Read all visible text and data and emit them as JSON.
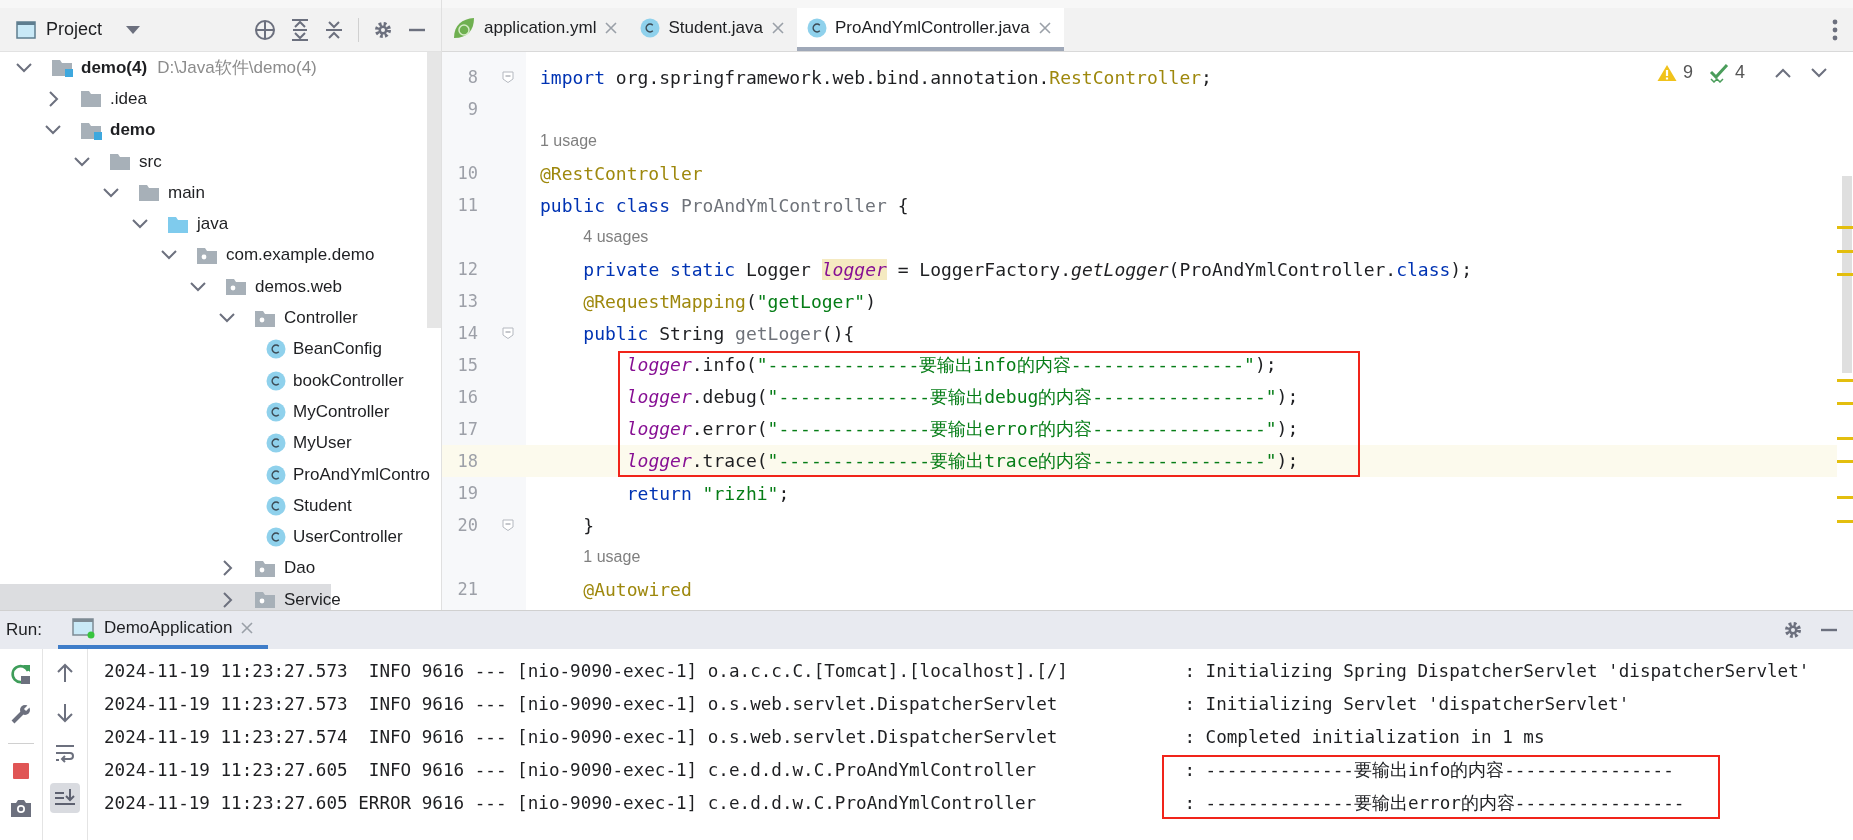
{
  "project_panel": {
    "title": "Project",
    "tree": [
      {
        "label": "demo(4)",
        "kind": "module",
        "bold": true,
        "path": "D:\\Java软件\\demo(4)",
        "expanded": true,
        "selected": false,
        "children": [
          {
            "label": ".idea",
            "kind": "folder",
            "bold": false,
            "expanded": false,
            "selected": false
          },
          {
            "label": "demo",
            "kind": "module",
            "bold": true,
            "expanded": true,
            "selected": false,
            "children": [
              {
                "label": "src",
                "kind": "folder",
                "bold": false,
                "expanded": true,
                "selected": false,
                "children": [
                  {
                    "label": "main",
                    "kind": "folder",
                    "bold": false,
                    "expanded": true,
                    "selected": false,
                    "children": [
                      {
                        "label": "java",
                        "kind": "source",
                        "bold": false,
                        "expanded": true,
                        "selected": false,
                        "children": [
                          {
                            "label": "com.example.demo",
                            "kind": "package",
                            "bold": false,
                            "expanded": true,
                            "selected": false,
                            "children": [
                              {
                                "label": "demos.web",
                                "kind": "package",
                                "bold": false,
                                "expanded": true,
                                "selected": false,
                                "children": [
                                  {
                                    "label": "Controller",
                                    "kind": "package",
                                    "bold": false,
                                    "expanded": true,
                                    "selected": false,
                                    "children": [
                                      {
                                        "label": "BeanConfig",
                                        "kind": "class",
                                        "bold": false,
                                        "selected": false
                                      },
                                      {
                                        "label": "bookController",
                                        "kind": "class",
                                        "bold": false,
                                        "selected": false
                                      },
                                      {
                                        "label": "MyController",
                                        "kind": "class",
                                        "bold": false,
                                        "selected": false
                                      },
                                      {
                                        "label": "MyUser",
                                        "kind": "class",
                                        "bold": false,
                                        "selected": false
                                      },
                                      {
                                        "label": "ProAndYmlContro",
                                        "kind": "class",
                                        "bold": false,
                                        "selected": false
                                      },
                                      {
                                        "label": "Student",
                                        "kind": "class",
                                        "bold": false,
                                        "selected": false
                                      },
                                      {
                                        "label": "UserController",
                                        "kind": "class",
                                        "bold": false,
                                        "selected": false
                                      }
                                    ]
                                  },
                                  {
                                    "label": "Dao",
                                    "kind": "package",
                                    "bold": false,
                                    "expanded": false,
                                    "selected": false
                                  },
                                  {
                                    "label": "Service",
                                    "kind": "package",
                                    "bold": false,
                                    "expanded": false,
                                    "selected": true
                                  }
                                ]
                              }
                            ]
                          }
                        ]
                      }
                    ]
                  }
                ]
              }
            ]
          }
        ]
      }
    ]
  },
  "editor": {
    "tabs": [
      {
        "label": "application.yml",
        "kind": "yaml",
        "selected": false
      },
      {
        "label": "Student.java",
        "kind": "class",
        "selected": false
      },
      {
        "label": "ProAndYmlController.java",
        "kind": "class",
        "selected": true
      }
    ],
    "inspections": {
      "warnings": "9",
      "weak_warnings": "4"
    },
    "lines": [
      {
        "kind": "code",
        "number": "8",
        "fold": true,
        "current": false,
        "spans": [
          {
            "text": "import",
            "kind": "keyword"
          },
          {
            "text": " org.springframework.web.bind.annotation.",
            "kind": "plain"
          },
          {
            "text": "RestController",
            "kind": "annotation"
          },
          {
            "text": ";",
            "kind": "plain"
          }
        ]
      },
      {
        "kind": "code",
        "number": "9",
        "fold": false,
        "current": false
      },
      {
        "kind": "hint",
        "text": "1 usage"
      },
      {
        "kind": "code",
        "number": "10",
        "fold": false,
        "current": false,
        "spans": [
          {
            "text": "@RestController",
            "kind": "annotation"
          }
        ]
      },
      {
        "kind": "code",
        "number": "11",
        "fold": false,
        "current": false,
        "spans": [
          {
            "text": "public class",
            "kind": "keyword"
          },
          {
            "text": " ProAndYmlController",
            "kind": "dim"
          },
          {
            "text": " {",
            "kind": "plain"
          }
        ]
      },
      {
        "kind": "hint",
        "text": "    4 usages"
      },
      {
        "kind": "code",
        "number": "12",
        "fold": false,
        "current": false,
        "spans": [
          {
            "text": "    private static",
            "kind": "keyword"
          },
          {
            "text": " Logger ",
            "kind": "plain"
          },
          {
            "text": "logger",
            "kind": "field_highlight"
          },
          {
            "text": " = LoggerFactory.",
            "kind": "plain"
          },
          {
            "text": "getLogger",
            "kind": "italic"
          },
          {
            "text": "(ProAndYmlController.",
            "kind": "plain"
          },
          {
            "text": "class",
            "kind": "keyword"
          },
          {
            "text": ");",
            "kind": "plain"
          }
        ]
      },
      {
        "kind": "code",
        "number": "13",
        "fold": false,
        "current": false,
        "spans": [
          {
            "text": "    @RequestMapping",
            "kind": "annotation"
          },
          {
            "text": "(",
            "kind": "plain"
          },
          {
            "text": "\"getLoger\"",
            "kind": "string"
          },
          {
            "text": ")",
            "kind": "plain"
          }
        ]
      },
      {
        "kind": "code",
        "number": "14",
        "fold": true,
        "current": false,
        "spans": [
          {
            "text": "    public",
            "kind": "keyword"
          },
          {
            "text": " String ",
            "kind": "plain"
          },
          {
            "text": "getLoger",
            "kind": "dim"
          },
          {
            "text": "(){",
            "kind": "plain"
          }
        ]
      },
      {
        "kind": "highlighted_group",
        "lines": [
          {
            "kind": "code",
            "number": "15",
            "fold": false,
            "current": false,
            "spans": [
              {
                "text": "        logger",
                "kind": "field"
              },
              {
                "text": ".info(",
                "kind": "plain"
              },
              {
                "text": "\"--------------要输出info的内容----------------\"",
                "kind": "string"
              },
              {
                "text": ");",
                "kind": "plain"
              }
            ]
          },
          {
            "kind": "code",
            "number": "16",
            "fold": false,
            "current": false,
            "spans": [
              {
                "text": "        logger",
                "kind": "field"
              },
              {
                "text": ".debug(",
                "kind": "plain"
              },
              {
                "text": "\"--------------要输出debug的内容----------------\"",
                "kind": "string"
              },
              {
                "text": ");",
                "kind": "plain"
              }
            ]
          },
          {
            "kind": "code",
            "number": "17",
            "fold": false,
            "current": false,
            "spans": [
              {
                "text": "        logger",
                "kind": "field"
              },
              {
                "text": ".error(",
                "kind": "plain"
              },
              {
                "text": "\"--------------要输出error的内容----------------\"",
                "kind": "string"
              },
              {
                "text": ");",
                "kind": "plain"
              }
            ]
          },
          {
            "kind": "code",
            "number": "18",
            "fold": false,
            "current": true,
            "spans": [
              {
                "text": "        logger",
                "kind": "field"
              },
              {
                "text": ".trace(",
                "kind": "plain"
              },
              {
                "text": "\"--------------要输出trace的内容----------------\"",
                "kind": "string"
              },
              {
                "text": ");",
                "kind": "plain"
              }
            ]
          }
        ]
      },
      {
        "kind": "code",
        "number": "19",
        "fold": false,
        "current": false,
        "spans": [
          {
            "text": "        return",
            "kind": "keyword"
          },
          {
            "text": " \"rizhi\"",
            "kind": "string"
          },
          {
            "text": ";",
            "kind": "plain"
          }
        ]
      },
      {
        "kind": "code",
        "number": "20",
        "fold": true,
        "current": false,
        "spans": [
          {
            "text": "    }",
            "kind": "plain"
          }
        ]
      },
      {
        "kind": "hint",
        "text": "    1 usage"
      },
      {
        "kind": "code",
        "number": "21",
        "fold": false,
        "current": false,
        "spans": [
          {
            "text": "    @Autowired",
            "kind": "annotation"
          }
        ]
      }
    ]
  },
  "run_panel": {
    "label": "Run:",
    "tabs": [
      {
        "label": "DemoApplication",
        "selected": true
      }
    ],
    "log": [
      {
        "source": "2024-11-19 11:23:27.573  INFO 9616 --- [nio-9090-exec-1] o.a.c.c.C.[Tomcat].[localhost].[/]",
        "message": ": Initializing Spring DispatcherServlet 'dispatcherServlet'"
      },
      {
        "source": "2024-11-19 11:23:27.573  INFO 9616 --- [nio-9090-exec-1] o.s.web.servlet.DispatcherServlet",
        "message": ": Initializing Servlet 'dispatcherServlet'"
      },
      {
        "source": "2024-11-19 11:23:27.574  INFO 9616 --- [nio-9090-exec-1] o.s.web.servlet.DispatcherServlet",
        "message": ": Completed initialization in 1 ms"
      },
      {
        "highlighted": [
          {
            "source": "2024-11-19 11:23:27.605  INFO 9616 --- [nio-9090-exec-1] c.e.d.d.w.C.ProAndYmlController",
            "message": ": --------------要输出info的内容----------------"
          },
          {
            "source": "2024-11-19 11:23:27.605 ERROR 9616 --- [nio-9090-exec-1] c.e.d.d.w.C.ProAndYmlController",
            "message": ": --------------要输出error的内容----------------"
          }
        ]
      }
    ]
  }
}
